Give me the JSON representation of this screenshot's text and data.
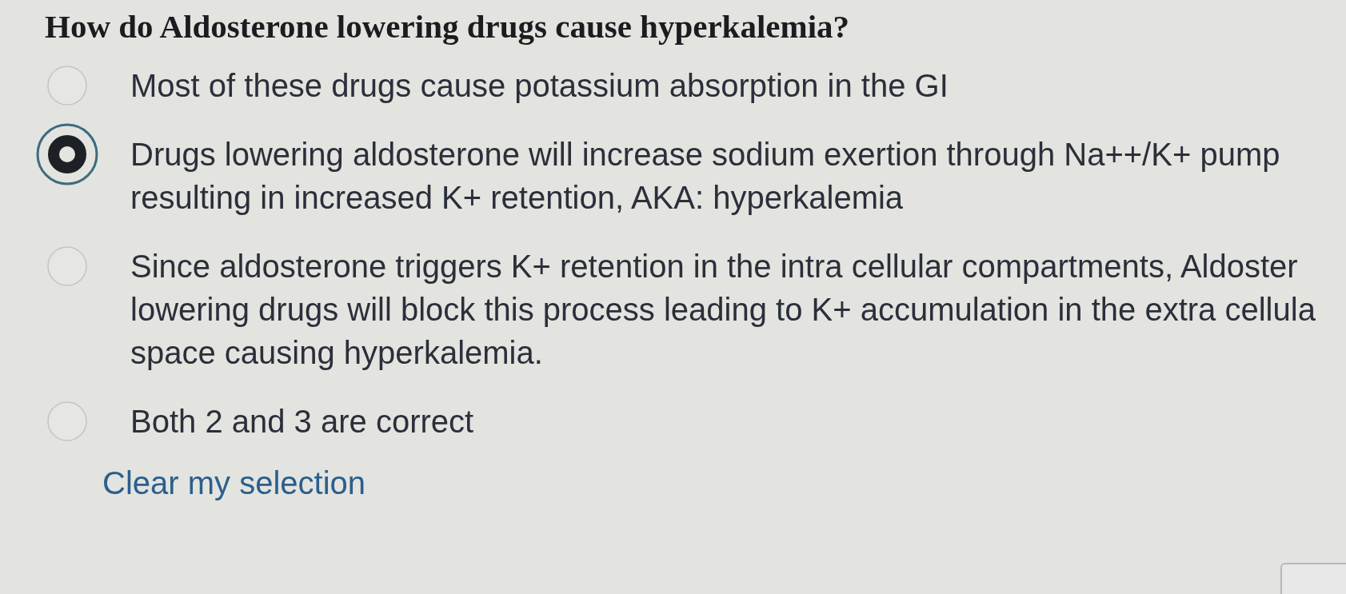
{
  "question": {
    "text": "How do Aldosterone lowering drugs cause hyperkalemia?"
  },
  "options": [
    {
      "lines": [
        "Most of these drugs cause potassium absorption in the GI"
      ],
      "selected": false
    },
    {
      "lines": [
        "Drugs lowering aldosterone will increase sodium exertion through Na++/K+ pump",
        "resulting in increased K+ retention, AKA: hyperkalemia"
      ],
      "selected": true
    },
    {
      "lines": [
        "Since aldosterone triggers K+ retention in the intra cellular compartments, Aldoster",
        "lowering drugs will block this process leading to K+ accumulation in the extra cellula",
        "space causing hyperkalemia."
      ],
      "selected": false
    },
    {
      "lines": [
        "Both 2 and 3 are correct"
      ],
      "selected": false
    }
  ],
  "clear_link": {
    "label": "Clear my selection"
  }
}
